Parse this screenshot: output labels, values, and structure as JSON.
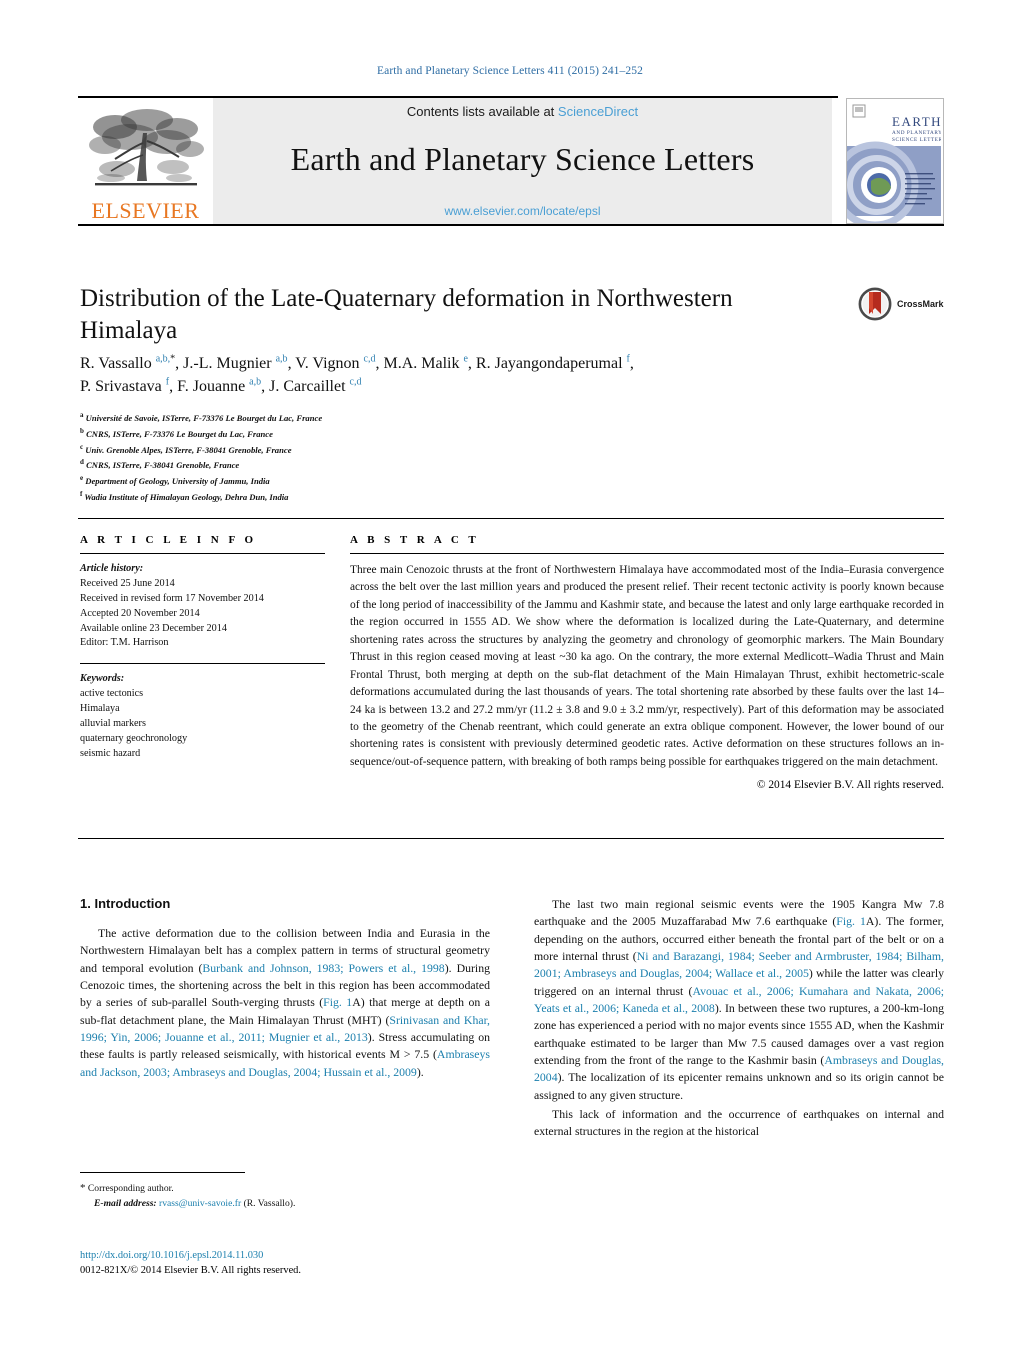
{
  "running_head": "Earth and Planetary Science Letters 411 (2015) 241–252",
  "masthead": {
    "publisher": "ELSEVIER",
    "contents_prefix": "Contents lists available at",
    "contents_link": "ScienceDirect",
    "journal_title": "Earth and Planetary Science Letters",
    "journal_url": "www.elsevier.com/locate/epsl",
    "cover_title_line1": "EARTH",
    "cover_title_line2": "AND PLANETARY",
    "cover_title_line3": "SCIENCE LETTERS"
  },
  "article": {
    "title": "Distribution of the Late-Quaternary deformation in Northwestern Himalaya",
    "crossmark_label": "CrossMark",
    "authors_line1_html": "R. Vassallo <sup>a,b,</sup><sup class=\"star\">*</sup>, J.-L. Mugnier <sup>a,b</sup>, V. Vignon <sup>c,d</sup>, M.A. Malik <sup>e</sup>, R. Jayangondaperumal <sup>f</sup>,",
    "authors_line2_html": "P. Srivastava <sup>f</sup>, F. Jouanne <sup>a,b</sup>, J. Carcaillet <sup>c,d</sup>",
    "affiliations": [
      {
        "mark": "a",
        "text": "Université de Savoie, ISTerre, F-73376 Le Bourget du Lac, France"
      },
      {
        "mark": "b",
        "text": "CNRS, ISTerre, F-73376 Le Bourget du Lac, France"
      },
      {
        "mark": "c",
        "text": "Univ. Grenoble Alpes, ISTerre, F-38041 Grenoble, France"
      },
      {
        "mark": "d",
        "text": "CNRS, ISTerre, F-38041 Grenoble, France"
      },
      {
        "mark": "e",
        "text": "Department of Geology, University of Jammu, India"
      },
      {
        "mark": "f",
        "text": "Wadia Institute of Himalayan Geology, Dehra Dun, India"
      }
    ]
  },
  "article_info": {
    "heading": "A R T I C L E    I N F O",
    "history_label": "Article history:",
    "history": [
      "Received 25 June 2014",
      "Received in revised form 17 November 2014",
      "Accepted 20 November 2014",
      "Available online 23 December 2014",
      "Editor: T.M. Harrison"
    ],
    "keywords_label": "Keywords:",
    "keywords": [
      "active tectonics",
      "Himalaya",
      "alluvial markers",
      "quaternary geochronology",
      "seismic hazard"
    ]
  },
  "abstract": {
    "heading": "A B S T R A C T",
    "text": "Three main Cenozoic thrusts at the front of Northwestern Himalaya have accommodated most of the India–Eurasia convergence across the belt over the last million years and produced the present relief. Their recent tectonic activity is poorly known because of the long period of inaccessibility of the Jammu and Kashmir state, and because the latest and only large earthquake recorded in the region occurred in 1555 AD. We show where the deformation is localized during the Late-Quaternary, and determine shortening rates across the structures by analyzing the geometry and chronology of geomorphic markers. The Main Boundary Thrust in this region ceased moving at least ~30 ka ago. On the contrary, the more external Medlicott–Wadia Thrust and Main Frontal Thrust, both merging at depth on the sub-flat detachment of the Main Himalayan Thrust, exhibit hectometric-scale deformations accumulated during the last thousands of years. The total shortening rate absorbed by these faults over the last 14–24 ka is between 13.2 and 27.2 mm/yr (11.2 ± 3.8 and 9.0 ± 3.2 mm/yr, respectively). Part of this deformation may be associated to the geometry of the Chenab reentrant, which could generate an extra oblique component. However, the lower bound of our shortening rates is consistent with previously determined geodetic rates. Active deformation on these structures follows an in-sequence/out-of-sequence pattern, with breaking of both ramps being possible for earthquakes triggered on the main detachment.",
    "copyright": "© 2014 Elsevier B.V. All rights reserved."
  },
  "body": {
    "section_heading": "1. Introduction",
    "left_paragraph_1_html": "The active deformation due to the collision between India and Eurasia in the Northwestern Himalayan belt has a complex pattern in terms of structural geometry and temporal evolution (<a class=\"ref\" href=\"#\">Burbank and Johnson, 1983; Powers et al., 1998</a>). During Cenozoic times, the shortening across the belt in this region has been accommodated by a series of sub-parallel South-verging thrusts (<a class=\"ref\" href=\"#\">Fig. 1</a>A) that merge at depth on a sub-flat detachment plane, the Main Himalayan Thrust (MHT) (<a class=\"ref\" href=\"#\">Srinivasan and Khar, 1996; Yin, 2006; Jouanne et al., 2011; Mugnier et al., 2013</a>). Stress accumulating on these faults is partly released seismically, with historical events M &gt; 7.5 (<a class=\"ref\" href=\"#\">Ambraseys and Jackson, 2003; Ambraseys and Douglas, 2004; Hussain et al., 2009</a>).",
    "right_paragraph_1_html": "The last two main regional seismic events were the 1905 Kangra Mw 7.8 earthquake and the 2005 Muzaffarabad Mw 7.6 earthquake (<a class=\"ref\" href=\"#\">Fig. 1</a>A). The former, depending on the authors, occurred either beneath the frontal part of the belt or on a more internal thrust (<a class=\"ref\" href=\"#\">Ni and Barazangi, 1984; Seeber and Armbruster, 1984; Bilham, 2001; Ambraseys and Douglas, 2004; Wallace et al., 2005</a>) while the latter was clearly triggered on an internal thrust (<a class=\"ref\" href=\"#\">Avouac et al., 2006; Kumahara and Nakata, 2006; Yeats et al., 2006; Kaneda et al., 2008</a>). In between these two ruptures, a 200-km-long zone has experienced a period with no major events since 1555 AD, when the Kashmir earthquake estimated to be larger than Mw 7.5 caused damages over a vast region extending from the front of the range to the Kashmir basin (<a class=\"ref\" href=\"#\">Ambraseys and Douglas, 2004</a>). The localization of its epicenter remains unknown and so its origin cannot be assigned to any given structure.",
    "right_paragraph_2_html": "This lack of information and the occurrence of earthquakes on internal and external structures in the region at the historical"
  },
  "footer": {
    "corresponding_author": "Corresponding author.",
    "email_label": "E-mail address:",
    "email": "rvass@univ-savoie.fr",
    "email_owner": "(R. Vassallo).",
    "doi": "http://dx.doi.org/10.1016/j.epsl.2014.11.030",
    "issn_line": "0012-821X/© 2014 Elsevier B.V. All rights reserved."
  },
  "colors": {
    "link_blue": "#1b7fad",
    "sciencedirect_blue": "#4a9fd4",
    "elsevier_orange": "#E87722",
    "runhead_blue": "#2e6da4"
  }
}
